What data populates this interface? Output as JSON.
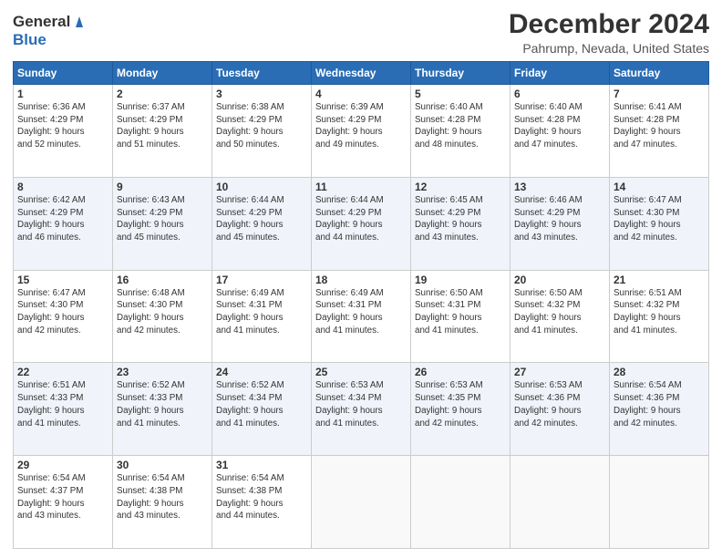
{
  "logo": {
    "general": "General",
    "blue": "Blue"
  },
  "title": "December 2024",
  "location": "Pahrump, Nevada, United States",
  "days_header": [
    "Sunday",
    "Monday",
    "Tuesday",
    "Wednesday",
    "Thursday",
    "Friday",
    "Saturday"
  ],
  "weeks": [
    [
      {
        "day": "1",
        "detail": "Sunrise: 6:36 AM\nSunset: 4:29 PM\nDaylight: 9 hours\nand 52 minutes."
      },
      {
        "day": "2",
        "detail": "Sunrise: 6:37 AM\nSunset: 4:29 PM\nDaylight: 9 hours\nand 51 minutes."
      },
      {
        "day": "3",
        "detail": "Sunrise: 6:38 AM\nSunset: 4:29 PM\nDaylight: 9 hours\nand 50 minutes."
      },
      {
        "day": "4",
        "detail": "Sunrise: 6:39 AM\nSunset: 4:29 PM\nDaylight: 9 hours\nand 49 minutes."
      },
      {
        "day": "5",
        "detail": "Sunrise: 6:40 AM\nSunset: 4:28 PM\nDaylight: 9 hours\nand 48 minutes."
      },
      {
        "day": "6",
        "detail": "Sunrise: 6:40 AM\nSunset: 4:28 PM\nDaylight: 9 hours\nand 47 minutes."
      },
      {
        "day": "7",
        "detail": "Sunrise: 6:41 AM\nSunset: 4:28 PM\nDaylight: 9 hours\nand 47 minutes."
      }
    ],
    [
      {
        "day": "8",
        "detail": "Sunrise: 6:42 AM\nSunset: 4:29 PM\nDaylight: 9 hours\nand 46 minutes."
      },
      {
        "day": "9",
        "detail": "Sunrise: 6:43 AM\nSunset: 4:29 PM\nDaylight: 9 hours\nand 45 minutes."
      },
      {
        "day": "10",
        "detail": "Sunrise: 6:44 AM\nSunset: 4:29 PM\nDaylight: 9 hours\nand 45 minutes."
      },
      {
        "day": "11",
        "detail": "Sunrise: 6:44 AM\nSunset: 4:29 PM\nDaylight: 9 hours\nand 44 minutes."
      },
      {
        "day": "12",
        "detail": "Sunrise: 6:45 AM\nSunset: 4:29 PM\nDaylight: 9 hours\nand 43 minutes."
      },
      {
        "day": "13",
        "detail": "Sunrise: 6:46 AM\nSunset: 4:29 PM\nDaylight: 9 hours\nand 43 minutes."
      },
      {
        "day": "14",
        "detail": "Sunrise: 6:47 AM\nSunset: 4:30 PM\nDaylight: 9 hours\nand 42 minutes."
      }
    ],
    [
      {
        "day": "15",
        "detail": "Sunrise: 6:47 AM\nSunset: 4:30 PM\nDaylight: 9 hours\nand 42 minutes."
      },
      {
        "day": "16",
        "detail": "Sunrise: 6:48 AM\nSunset: 4:30 PM\nDaylight: 9 hours\nand 42 minutes."
      },
      {
        "day": "17",
        "detail": "Sunrise: 6:49 AM\nSunset: 4:31 PM\nDaylight: 9 hours\nand 41 minutes."
      },
      {
        "day": "18",
        "detail": "Sunrise: 6:49 AM\nSunset: 4:31 PM\nDaylight: 9 hours\nand 41 minutes."
      },
      {
        "day": "19",
        "detail": "Sunrise: 6:50 AM\nSunset: 4:31 PM\nDaylight: 9 hours\nand 41 minutes."
      },
      {
        "day": "20",
        "detail": "Sunrise: 6:50 AM\nSunset: 4:32 PM\nDaylight: 9 hours\nand 41 minutes."
      },
      {
        "day": "21",
        "detail": "Sunrise: 6:51 AM\nSunset: 4:32 PM\nDaylight: 9 hours\nand 41 minutes."
      }
    ],
    [
      {
        "day": "22",
        "detail": "Sunrise: 6:51 AM\nSunset: 4:33 PM\nDaylight: 9 hours\nand 41 minutes."
      },
      {
        "day": "23",
        "detail": "Sunrise: 6:52 AM\nSunset: 4:33 PM\nDaylight: 9 hours\nand 41 minutes."
      },
      {
        "day": "24",
        "detail": "Sunrise: 6:52 AM\nSunset: 4:34 PM\nDaylight: 9 hours\nand 41 minutes."
      },
      {
        "day": "25",
        "detail": "Sunrise: 6:53 AM\nSunset: 4:34 PM\nDaylight: 9 hours\nand 41 minutes."
      },
      {
        "day": "26",
        "detail": "Sunrise: 6:53 AM\nSunset: 4:35 PM\nDaylight: 9 hours\nand 42 minutes."
      },
      {
        "day": "27",
        "detail": "Sunrise: 6:53 AM\nSunset: 4:36 PM\nDaylight: 9 hours\nand 42 minutes."
      },
      {
        "day": "28",
        "detail": "Sunrise: 6:54 AM\nSunset: 4:36 PM\nDaylight: 9 hours\nand 42 minutes."
      }
    ],
    [
      {
        "day": "29",
        "detail": "Sunrise: 6:54 AM\nSunset: 4:37 PM\nDaylight: 9 hours\nand 43 minutes."
      },
      {
        "day": "30",
        "detail": "Sunrise: 6:54 AM\nSunset: 4:38 PM\nDaylight: 9 hours\nand 43 minutes."
      },
      {
        "day": "31",
        "detail": "Sunrise: 6:54 AM\nSunset: 4:38 PM\nDaylight: 9 hours\nand 44 minutes."
      },
      {
        "day": "",
        "detail": ""
      },
      {
        "day": "",
        "detail": ""
      },
      {
        "day": "",
        "detail": ""
      },
      {
        "day": "",
        "detail": ""
      }
    ]
  ]
}
